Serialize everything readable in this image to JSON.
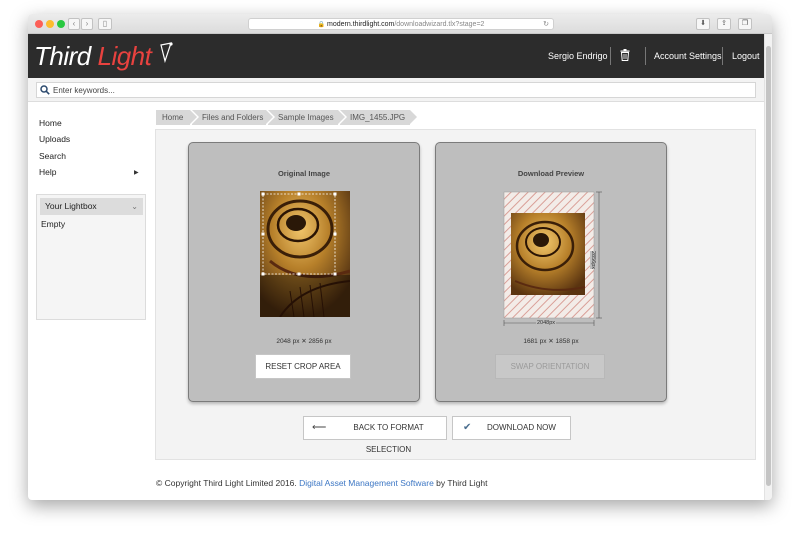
{
  "browser": {
    "url_host": "modern.thirdlight.com",
    "url_path": "/downloadwizard.tlx?stage=2"
  },
  "header": {
    "logo_third": "Third",
    "logo_light": "Light",
    "user_name": "Sergio Endrigo",
    "account_settings": "Account Settings",
    "logout": "Logout"
  },
  "search": {
    "placeholder": "Enter keywords..."
  },
  "sidebar": {
    "items": [
      "Home",
      "Uploads",
      "Search",
      "Help"
    ],
    "lightbox_title": "Your Lightbox",
    "lightbox_status": "Empty"
  },
  "breadcrumb": [
    "Home",
    "Files and Folders",
    "Sample Images",
    "IMG_1455.JPG"
  ],
  "original_panel": {
    "title": "Original Image",
    "dimensions": "2048 px ✕ 2856 px",
    "button": "RESET CROP AREA"
  },
  "preview_panel": {
    "title": "Download Preview",
    "dimensions": "1681 px ✕ 1858 px",
    "width_label": "2048px",
    "height_label": "2856px",
    "button": "SWAP ORIENTATION"
  },
  "actions": {
    "back": "BACK TO FORMAT SELECTION",
    "download": "DOWNLOAD NOW"
  },
  "footer": {
    "text_before": "© Copyright Third Light Limited 2016.",
    "link": "Digital Asset Management Software",
    "text_after": "by Third Light"
  },
  "colors": {
    "header_bg": "#2c2c2c",
    "logo_accent": "#e8423f",
    "footer_link": "#3d77c4",
    "panel_bg": "#bebebe",
    "download_check": "#4a6e8f"
  }
}
